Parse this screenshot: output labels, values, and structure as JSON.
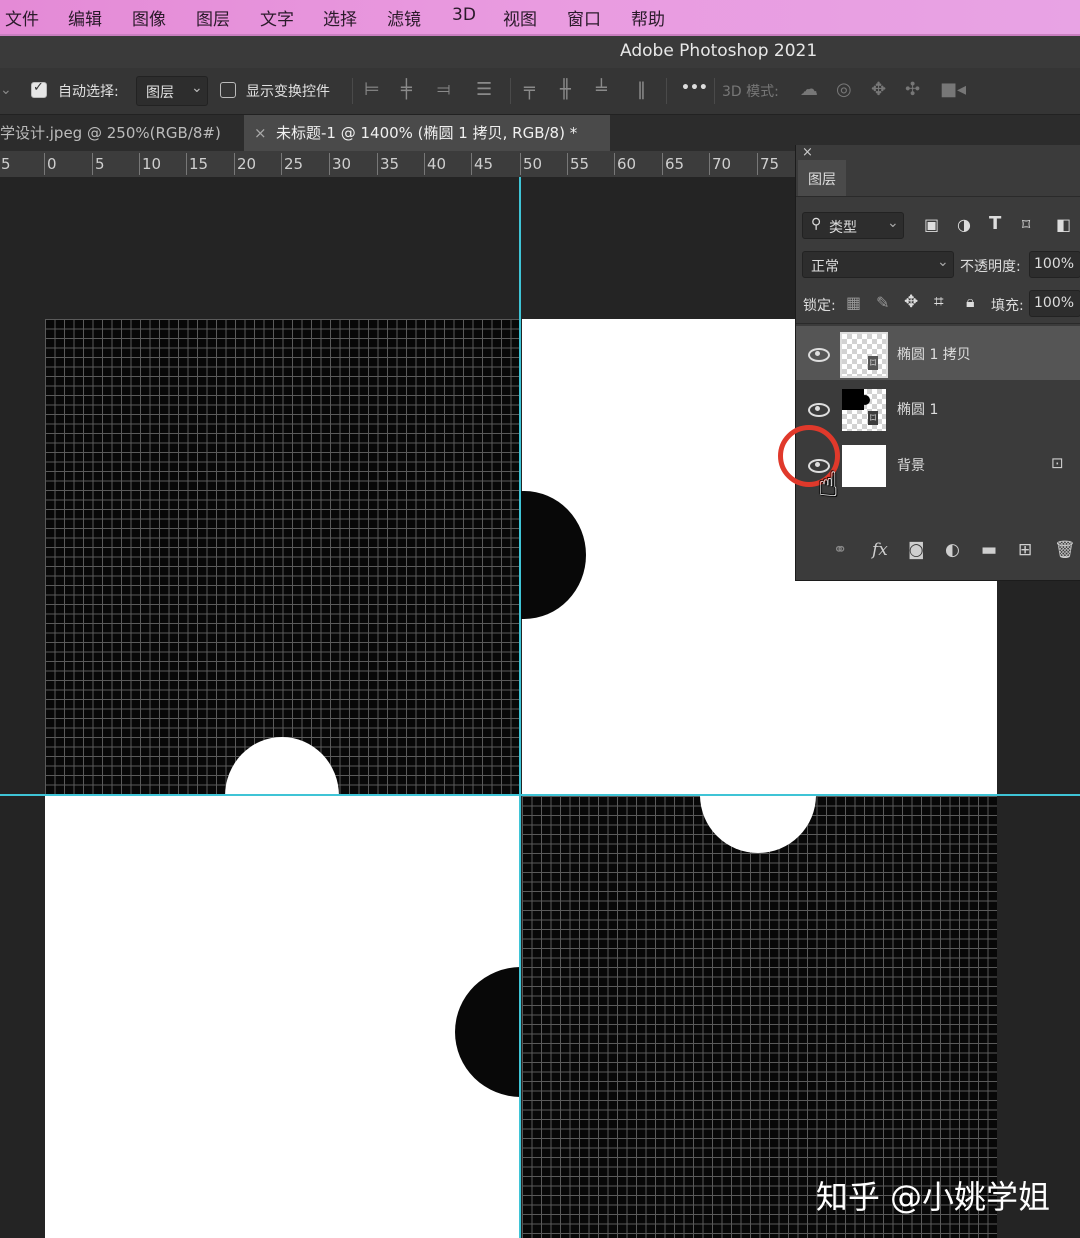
{
  "menu": [
    "文件",
    "编辑",
    "图像",
    "图层",
    "文字",
    "选择",
    "滤镜",
    "3D",
    "视图",
    "窗口",
    "帮助"
  ],
  "window_title": "Adobe Photoshop 2021",
  "options": {
    "auto_select_label": "自动选择:",
    "auto_select_value": "图层",
    "show_transform_label": "显示变换控件",
    "mode_3d_label": "3D 模式:",
    "more_label": "•••"
  },
  "tabs": [
    {
      "label": "学设计.jpeg @ 250%(RGB/8#)",
      "active": false
    },
    {
      "label": "未标题-1 @ 1400% (椭圆 1 拷贝, RGB/8) *",
      "active": true
    }
  ],
  "ruler_ticks": [
    "5",
    "0",
    "5",
    "10",
    "15",
    "20",
    "25",
    "30",
    "35",
    "40",
    "45",
    "50",
    "55",
    "60",
    "65",
    "70",
    "75"
  ],
  "layers_panel": {
    "title": "图层",
    "close": "×",
    "filter_label": "类型",
    "blend_mode": "正常",
    "opacity_label": "不透明度:",
    "opacity_value": "100%",
    "lock_label": "锁定:",
    "fill_label": "填充:",
    "fill_value": "100%",
    "layers": [
      {
        "name": "椭圆 1 拷贝",
        "visible": true,
        "selected": true
      },
      {
        "name": "椭圆 1",
        "visible": true,
        "selected": false
      },
      {
        "name": "背景",
        "visible": true,
        "selected": false,
        "locked": true
      }
    ]
  },
  "watermark": "知乎 @小姚学姐",
  "colors": {
    "menu_bar": "#e99be0",
    "guide": "#3fc4d6",
    "cursor_ring": "#e0392b"
  }
}
